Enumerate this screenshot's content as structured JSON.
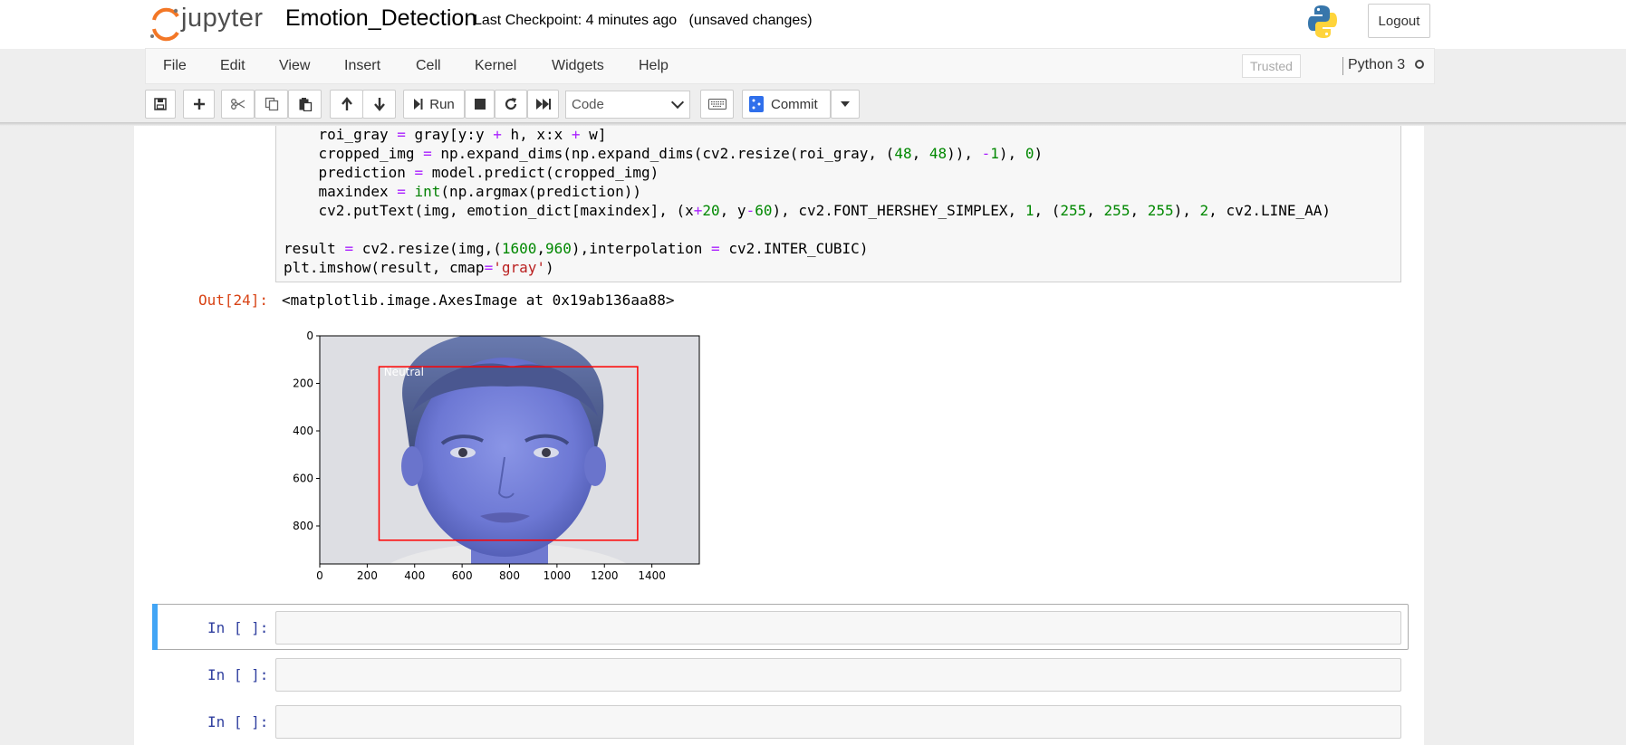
{
  "header": {
    "logo_text": "jupyter",
    "notebook_name": "Emotion_Detection",
    "checkpoint": "Last Checkpoint: 4 minutes ago",
    "unsaved": "(unsaved changes)",
    "logout_label": "Logout"
  },
  "menu": {
    "items": [
      "File",
      "Edit",
      "View",
      "Insert",
      "Cell",
      "Kernel",
      "Widgets",
      "Help"
    ],
    "trusted": "Trusted",
    "kernel_name": "Python 3"
  },
  "toolbar": {
    "run_label": "Run",
    "cell_type": "Code",
    "commit_label": "Commit"
  },
  "cell": {
    "output_prompt": "Out[24]:",
    "output_text": "<matplotlib.image.AxesImage at 0x19ab136aa88>"
  },
  "empty_cells": [
    {
      "prompt": "In [ ]:"
    },
    {
      "prompt": "In [ ]:"
    },
    {
      "prompt": "In [ ]:"
    }
  ],
  "plot": {
    "xticks": [
      "0",
      "200",
      "400",
      "600",
      "800",
      "1000",
      "1200",
      "1400"
    ],
    "yticks": [
      "0",
      "200",
      "400",
      "600",
      "800"
    ],
    "box_label": "Neutral"
  },
  "chart_data": {
    "type": "image",
    "xlim": [
      0,
      1600
    ],
    "ylim": [
      960,
      0
    ],
    "xticks": [
      0,
      200,
      400,
      600,
      800,
      1000,
      1200,
      1400
    ],
    "yticks": [
      0,
      200,
      400,
      600,
      800
    ],
    "detection_box": {
      "x0": 250,
      "y0": 130,
      "x1": 1340,
      "y1": 860,
      "label": "Neutral",
      "color": "#ff0000"
    }
  },
  "colors": {
    "out_prompt": "#d84315",
    "in_prompt": "#303f9f",
    "selected_bar": "#42a5f5",
    "commit_icon": "#2f6feb"
  }
}
